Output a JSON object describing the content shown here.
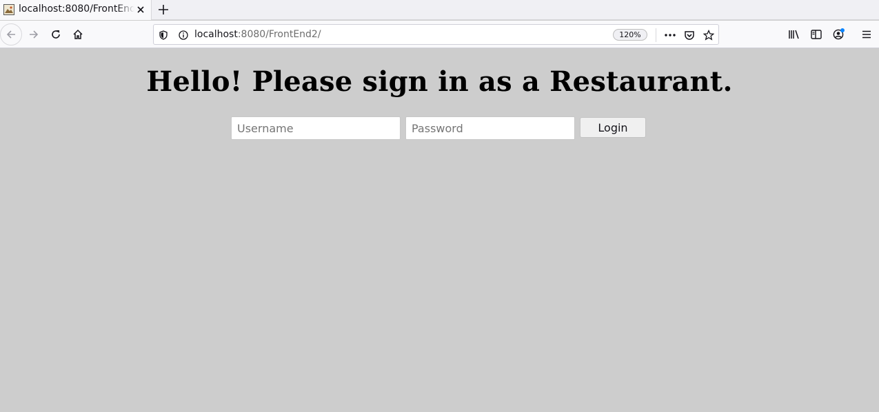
{
  "browser": {
    "tab": {
      "title": "localhost:8080/FrontEnd2/",
      "favicon": "image-favicon-icon",
      "close_icon": "close-icon"
    },
    "new_tab_icon": "plus-icon",
    "nav": {
      "back_icon": "arrow-left-icon",
      "forward_icon": "arrow-right-icon",
      "reload_icon": "reload-icon",
      "home_icon": "home-icon"
    },
    "urlbar": {
      "host": "localhost",
      "path": ":8080/FrontEnd2/",
      "zoom": "120%",
      "shield_icon": "shield-icon",
      "info_icon": "info-icon",
      "page_actions_icon": "meatball-menu-icon",
      "pocket_icon": "pocket-icon",
      "bookmark_icon": "star-icon"
    },
    "toolbar": {
      "library_icon": "library-icon",
      "sidebar_icon": "sidebar-icon",
      "account_icon": "account-icon",
      "menu_icon": "hamburger-menu-icon"
    },
    "colors": {
      "page_background": "#cdcdcd",
      "chrome_background": "#f9f9fb",
      "notification_dot": "#0a84ff"
    }
  },
  "page": {
    "heading": "Hello! Please sign in as a Restaurant.",
    "form": {
      "username": {
        "value": "",
        "placeholder": "Username"
      },
      "password": {
        "value": "",
        "placeholder": "Password"
      },
      "login_label": "Login"
    }
  }
}
